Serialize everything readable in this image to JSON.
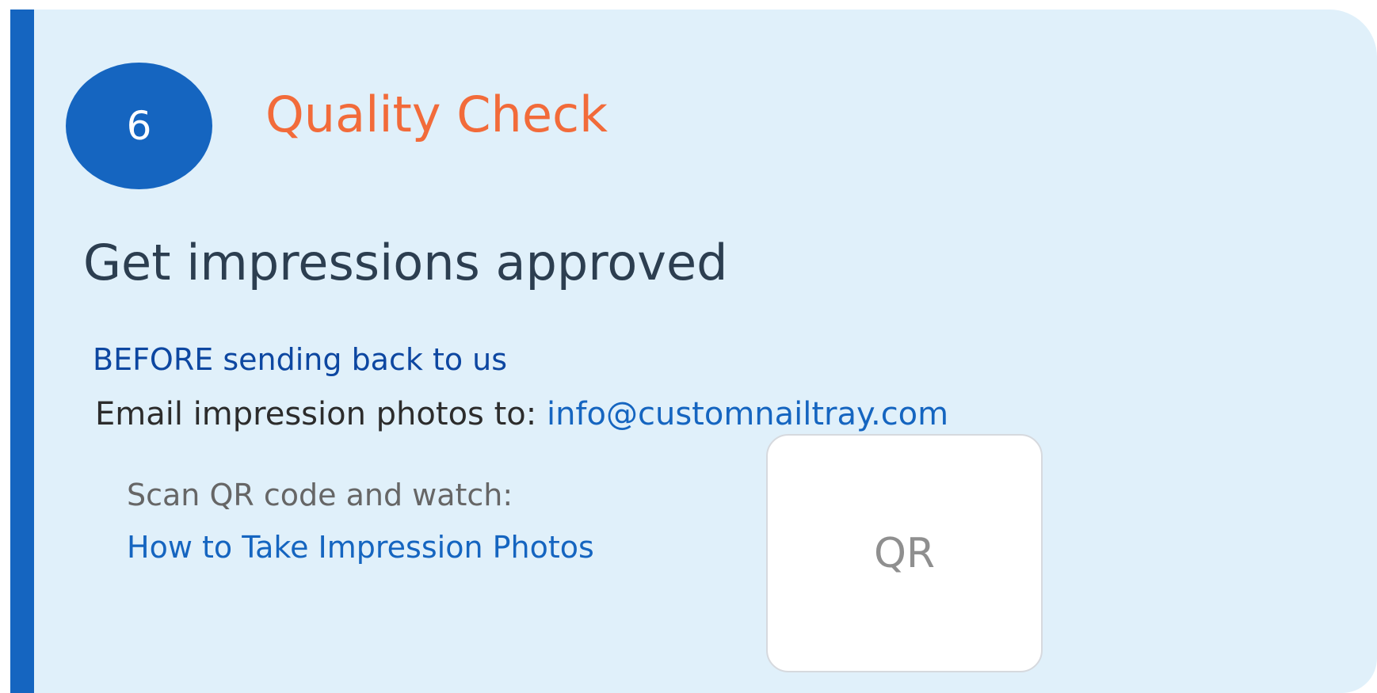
{
  "step": {
    "number": "6",
    "title": "Quality Check"
  },
  "heading": "Get impressions approved",
  "before_text": "BEFORE sending back to us",
  "email": {
    "label": "Email impression photos to:",
    "address": "info@customnailtray.com"
  },
  "video": {
    "scan_text": "Scan QR code and watch:",
    "link_text": "How to Take Impression Photos"
  },
  "qr": {
    "placeholder": "QR"
  },
  "colors": {
    "accent_blue": "#1565c0",
    "card_background": "#e0f0fa",
    "title_orange": "#f26b3a",
    "heading_dark": "#2c3e50",
    "before_dark_blue": "#0d47a1"
  }
}
